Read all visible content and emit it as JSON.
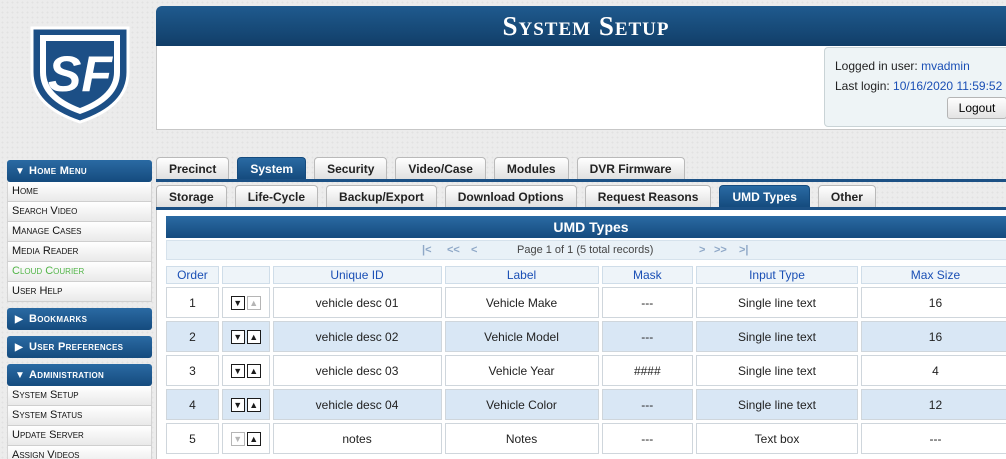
{
  "header": {
    "title": "System Setup",
    "logged_in_label": "Logged in user:",
    "logged_in_user": "mvadmin",
    "last_login_label": "Last login:",
    "last_login_value": "10/16/2020 11:59:52",
    "logout_label": "Logout"
  },
  "sidebar": {
    "home_menu": "Home Menu",
    "home_items": [
      "Home",
      "Search Video",
      "Manage Cases",
      "Media Reader",
      "Cloud Courier",
      "User Help"
    ],
    "bookmarks": "Bookmarks",
    "user_preferences": "User Preferences",
    "administration": "Administration",
    "admin_items": [
      "System Setup",
      "System Status",
      "Update Server",
      "Assign Videos"
    ]
  },
  "tabs_row1": [
    "Precinct",
    "System",
    "Security",
    "Video/Case",
    "Modules",
    "DVR Firmware"
  ],
  "tabs_row1_active": "System",
  "tabs_row2": [
    "Storage",
    "Life-Cycle",
    "Backup/Export",
    "Download Options",
    "Request Reasons",
    "UMD Types",
    "Other"
  ],
  "tabs_row2_active": "UMD Types",
  "section": {
    "title": "UMD Types",
    "pager_text": "Page 1 of 1 (5 total records)",
    "pager_first": "|<",
    "pager_prev_many": "<<",
    "pager_prev": "<",
    "pager_next": ">",
    "pager_next_many": ">>",
    "pager_last": ">|"
  },
  "table": {
    "columns": [
      "Order",
      "",
      "Unique ID",
      "Label",
      "Mask",
      "Input Type",
      "Max Size"
    ],
    "rows": [
      {
        "order": "1",
        "unique_id": "vehicle desc 01",
        "label": "Vehicle Make",
        "mask": "---",
        "input_type": "Single line text",
        "max_size": "16"
      },
      {
        "order": "2",
        "unique_id": "vehicle desc 02",
        "label": "Vehicle Model",
        "mask": "---",
        "input_type": "Single line text",
        "max_size": "16"
      },
      {
        "order": "3",
        "unique_id": "vehicle desc 03",
        "label": "Vehicle Year",
        "mask": "####",
        "input_type": "Single line text",
        "max_size": "4"
      },
      {
        "order": "4",
        "unique_id": "vehicle desc 04",
        "label": "Vehicle Color",
        "mask": "---",
        "input_type": "Single line text",
        "max_size": "12"
      },
      {
        "order": "5",
        "unique_id": "notes",
        "label": "Notes",
        "mask": "---",
        "input_type": "Text box",
        "max_size": "---"
      }
    ]
  },
  "colors": {
    "brand_blue": "#154b7e",
    "link_blue": "#1a4fb5",
    "alt_row": "#d9e7f5",
    "green_item": "#52b548"
  },
  "logo_text": "SF"
}
